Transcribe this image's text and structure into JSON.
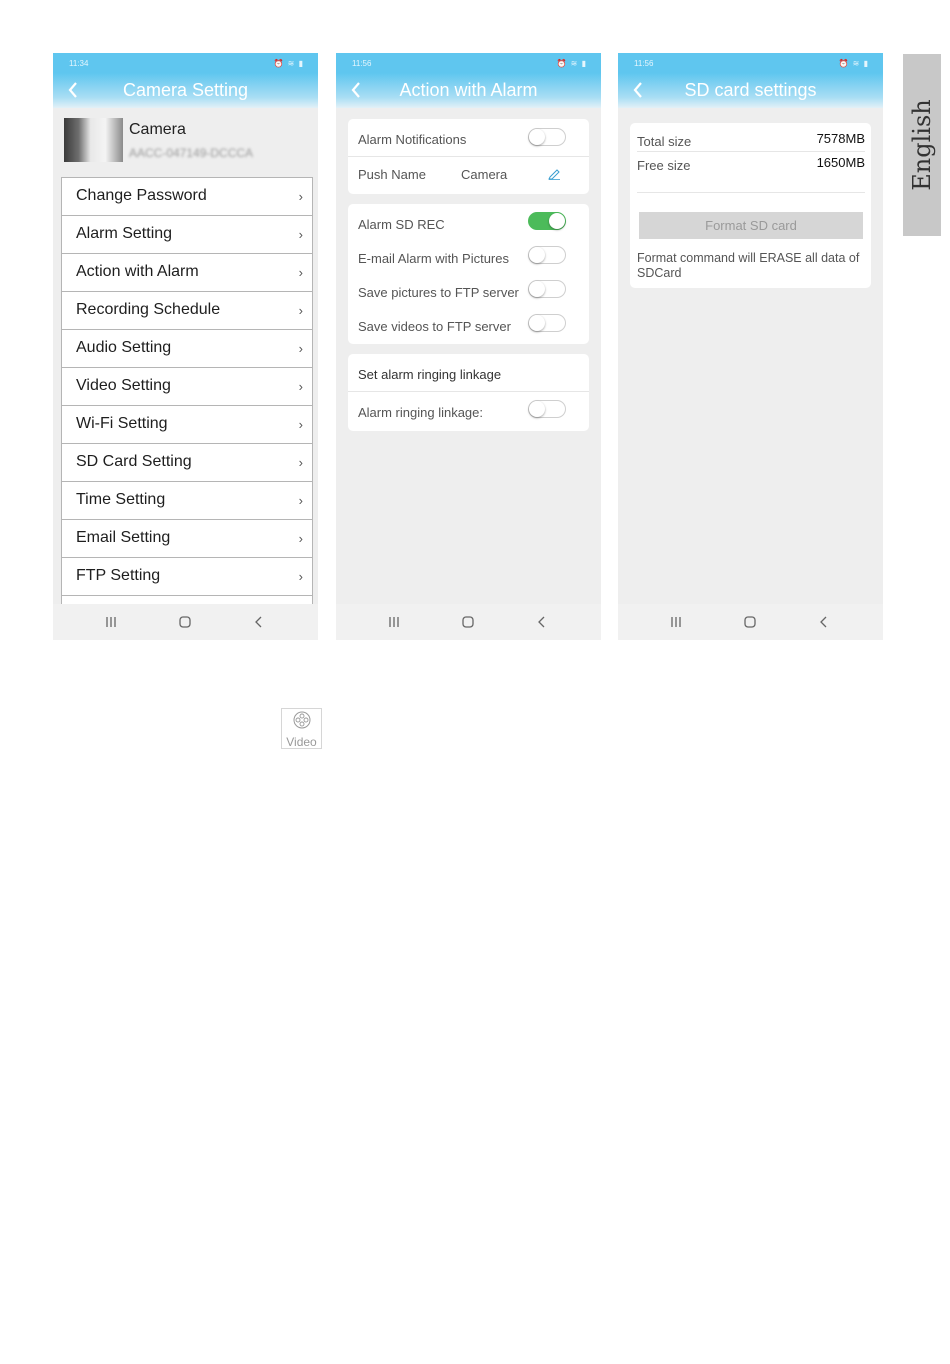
{
  "side_tab": {
    "language": "English"
  },
  "screen1": {
    "status_time": "11:34",
    "title": "Camera Setting",
    "camera_name": "Camera",
    "camera_id": "AACC-047149-DCCCA",
    "menu": [
      "Change Password",
      "Alarm Setting",
      "Action with Alarm",
      "Recording Schedule",
      "Audio Setting",
      "Video Setting",
      "Wi-Fi Setting",
      "SD Card Setting",
      "Time Setting",
      "Email Setting",
      "FTP Setting"
    ]
  },
  "screen2": {
    "status_time": "11:56",
    "title": "Action with Alarm",
    "alarm_notifications": "Alarm Notifications",
    "push_name_label": "Push Name",
    "push_name_value": "Camera",
    "alarm_sd_rec": "Alarm SD REC",
    "email_alarm": "E-mail Alarm with Pictures",
    "save_pictures_ftp": "Save pictures to FTP server",
    "save_videos_ftp": "Save videos to FTP server",
    "set_ringing_linkage": "Set alarm ringing linkage",
    "ringing_linkage": "Alarm ringing linkage:",
    "toggles": {
      "alarm_notifications": false,
      "alarm_sd_rec": true,
      "email_alarm": false,
      "save_pictures_ftp": false,
      "save_videos_ftp": false,
      "ringing_linkage": false
    },
    "toggle_on_color": "#4cbb5a"
  },
  "screen3": {
    "status_time": "11:56",
    "title": "SD card settings",
    "total_size_label": "Total size",
    "total_size_value": "7578MB",
    "free_size_label": "Free size",
    "free_size_value": "1650MB",
    "format_button": "Format SD card",
    "format_note": "Format command will ERASE all data of SDCard"
  },
  "video_icon": {
    "label": "Video",
    "icon": "film-reel-icon"
  },
  "colors": {
    "header": "#5fc6ef",
    "background": "#eeeeee"
  }
}
